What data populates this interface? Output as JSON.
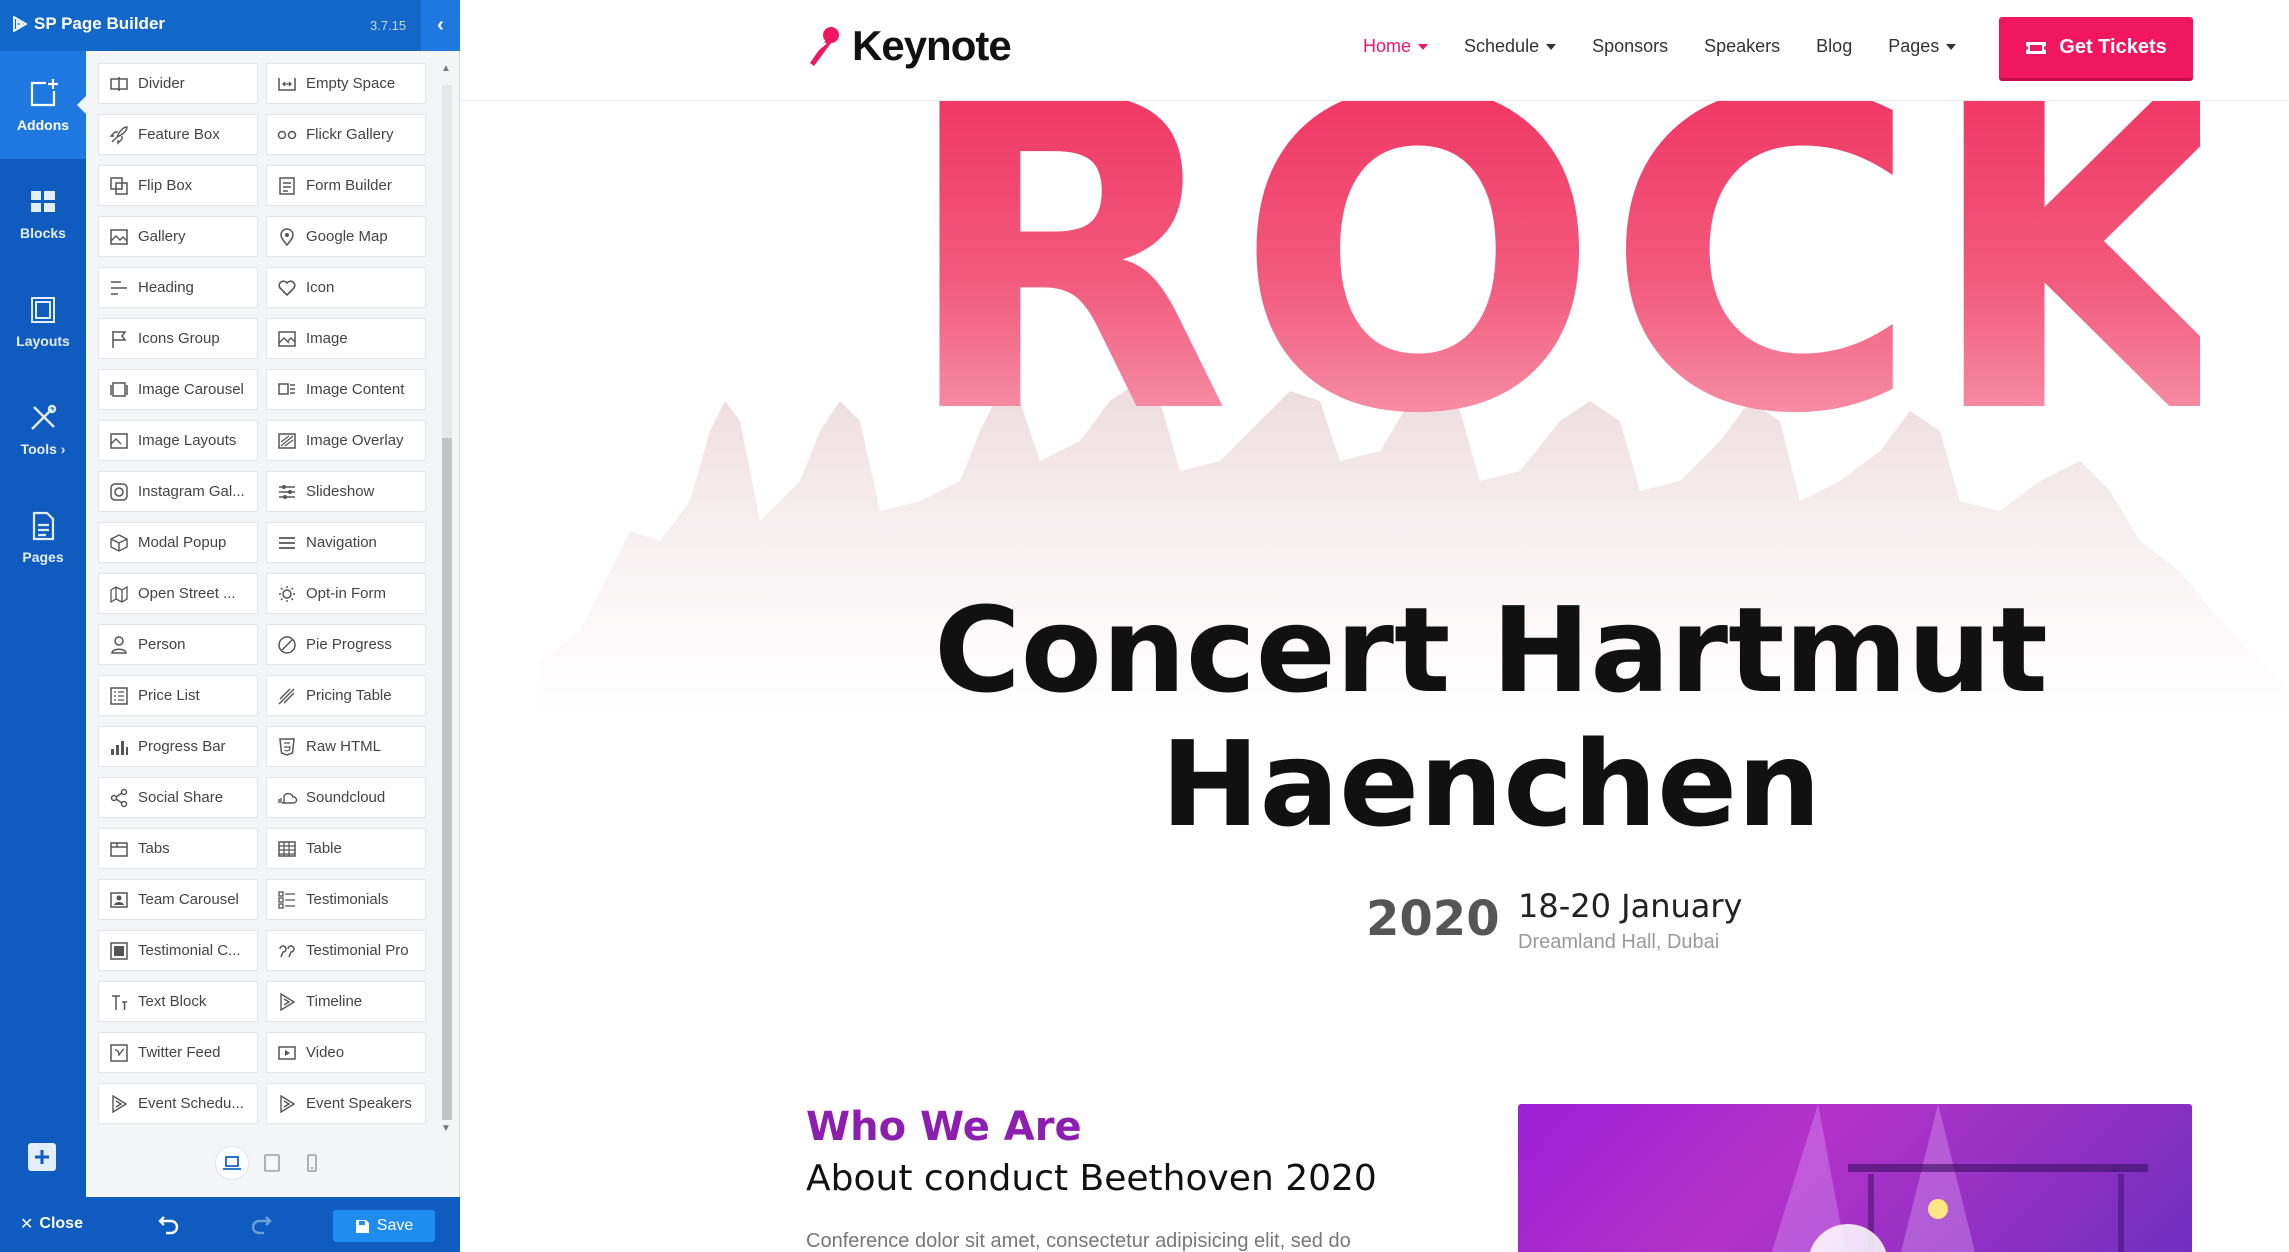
{
  "builder": {
    "title": "SP Page Builder",
    "version": "3.7.15",
    "rail": [
      {
        "label": "Addons"
      },
      {
        "label": "Blocks"
      },
      {
        "label": "Layouts"
      },
      {
        "label": "Tools ›"
      },
      {
        "label": "Pages"
      }
    ],
    "addons": [
      {
        "label": "Divider",
        "icon": "divider-icon"
      },
      {
        "label": "Empty Space",
        "icon": "empty-space-icon"
      },
      {
        "label": "Feature Box",
        "icon": "rocket-icon"
      },
      {
        "label": "Flickr Gallery",
        "icon": "flickr-icon"
      },
      {
        "label": "Flip Box",
        "icon": "flip-box-icon"
      },
      {
        "label": "Form Builder",
        "icon": "form-icon"
      },
      {
        "label": "Gallery",
        "icon": "gallery-icon"
      },
      {
        "label": "Google Map",
        "icon": "map-pin-icon"
      },
      {
        "label": "Heading",
        "icon": "heading-icon"
      },
      {
        "label": "Icon",
        "icon": "heart-icon"
      },
      {
        "label": "Icons Group",
        "icon": "flag-icon"
      },
      {
        "label": "Image",
        "icon": "image-icon"
      },
      {
        "label": "Image Carousel",
        "icon": "image-carousel-icon"
      },
      {
        "label": "Image Content",
        "icon": "image-content-icon"
      },
      {
        "label": "Image Layouts",
        "icon": "image-layouts-icon"
      },
      {
        "label": "Image Overlay",
        "icon": "image-overlay-icon"
      },
      {
        "label": "Instagram Gal...",
        "icon": "instagram-icon"
      },
      {
        "label": "Slideshow",
        "icon": "slideshow-icon"
      },
      {
        "label": "Modal Popup",
        "icon": "cube-icon"
      },
      {
        "label": "Navigation",
        "icon": "menu-icon"
      },
      {
        "label": "Open Street ...",
        "icon": "open-street-map-icon"
      },
      {
        "label": "Opt-in Form",
        "icon": "opt-in-form-icon"
      },
      {
        "label": "Person",
        "icon": "person-icon"
      },
      {
        "label": "Pie Progress",
        "icon": "pie-progress-icon"
      },
      {
        "label": "Price List",
        "icon": "price-list-icon"
      },
      {
        "label": "Pricing Table",
        "icon": "pricing-table-icon"
      },
      {
        "label": "Progress Bar",
        "icon": "progress-bar-icon"
      },
      {
        "label": "Raw HTML",
        "icon": "html5-icon"
      },
      {
        "label": "Social Share",
        "icon": "share-icon"
      },
      {
        "label": "Soundcloud",
        "icon": "soundcloud-icon"
      },
      {
        "label": "Tabs",
        "icon": "tabs-icon"
      },
      {
        "label": "Table",
        "icon": "table-icon"
      },
      {
        "label": "Team Carousel",
        "icon": "team-carousel-icon"
      },
      {
        "label": "Testimonials",
        "icon": "testimonials-icon"
      },
      {
        "label": "Testimonial C...",
        "icon": "testimonial-carousel-icon"
      },
      {
        "label": "Testimonial Pro",
        "icon": "quote-icon"
      },
      {
        "label": "Text Block",
        "icon": "text-block-icon"
      },
      {
        "label": "Timeline",
        "icon": "play-icon"
      },
      {
        "label": "Twitter Feed",
        "icon": "twitter-feed-icon"
      },
      {
        "label": "Video",
        "icon": "video-icon"
      },
      {
        "label": "Event Schedu...",
        "icon": "play-icon"
      },
      {
        "label": "Event Speakers",
        "icon": "play-icon"
      }
    ],
    "footer": {
      "close_label": "Close",
      "save_label": "Save"
    }
  },
  "site": {
    "brand": "Keynote",
    "nav": [
      {
        "label": "Home",
        "dropdown": true,
        "active": true
      },
      {
        "label": "Schedule",
        "dropdown": true,
        "active": false
      },
      {
        "label": "Sponsors",
        "dropdown": false,
        "active": false
      },
      {
        "label": "Speakers",
        "dropdown": false,
        "active": false
      },
      {
        "label": "Blog",
        "dropdown": false,
        "active": false
      },
      {
        "label": "Pages",
        "dropdown": true,
        "active": false
      }
    ],
    "tickets_label": "Get Tickets",
    "hero": {
      "big_word": "ROCK",
      "title_line1": "Concert Hartmut",
      "title_line2": "Haenchen",
      "year": "2020",
      "date": "18-20 January",
      "venue": "Dreamland Hall, Dubai"
    },
    "about": {
      "kicker": "Who We Are",
      "title": "About conduct Beethoven 2020",
      "text": "Conference dolor sit amet, consectetur adipisicing elit, sed do"
    }
  },
  "colors": {
    "builder_blue": "#1367c9",
    "rail_blue": "#0f5bbf",
    "accent_pink": "#f0165f",
    "purple": "#8d1fb0"
  }
}
